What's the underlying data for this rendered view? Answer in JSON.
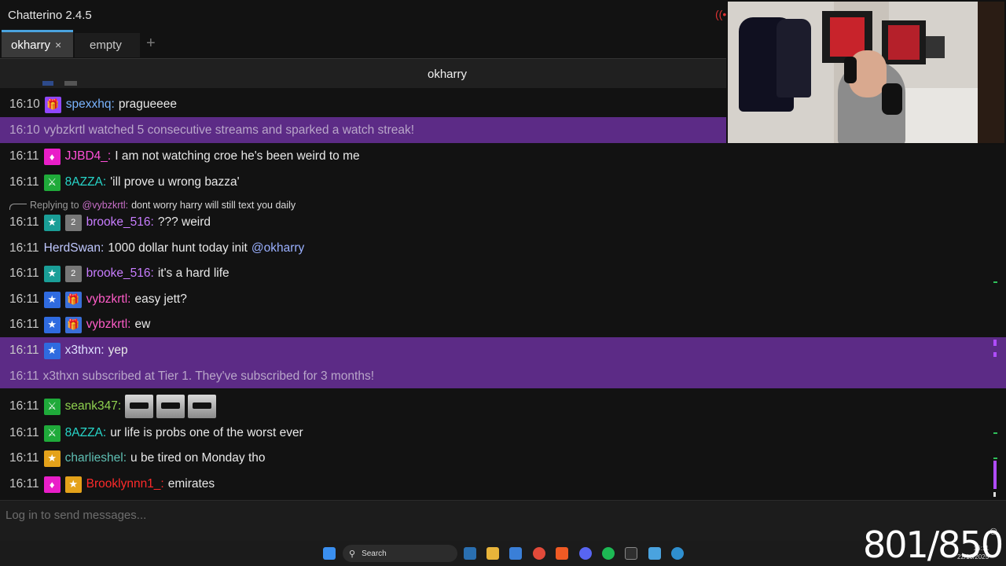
{
  "window": {
    "title": "Chatterino 2.4.5"
  },
  "tabs": [
    {
      "label": "okharry",
      "active": true
    },
    {
      "label": "empty",
      "active": false
    }
  ],
  "icons": {
    "add_tab": "+",
    "close_tab": "×",
    "live": "((•))",
    "emoji": "☺"
  },
  "chat": {
    "channel": "okharry",
    "messages": [
      {
        "time": "16:10",
        "user": "spexxhq:",
        "text": "pragueeee",
        "color": "#7ab4ff"
      },
      {
        "time": "16:10",
        "system": "vybzkrtl watched 5 consecutive streams and sparked a watch streak!"
      },
      {
        "time": "16:11",
        "user": "JJBD4_:",
        "text": "I am not watching croe he's been weird to me",
        "color": "#ff4fd8"
      },
      {
        "time": "16:11",
        "user": "8AZZA:",
        "text": "'ill prove u wrong bazza'",
        "color": "#27d4c8"
      },
      {
        "reply_prefix": "Replying to",
        "reply_target": "@vybzkrtl:",
        "reply_text": "dont worry harry will still text you daily"
      },
      {
        "time": "16:11",
        "user": "brooke_516:",
        "text": "??? weird",
        "color": "#c87dff"
      },
      {
        "time": "16:11",
        "user": "HerdSwan:",
        "text": "1000 dollar hunt today init",
        "mention": "@okharry",
        "color": "#c0c8ff"
      },
      {
        "time": "16:11",
        "user": "brooke_516:",
        "text": "it's a hard life",
        "color": "#c87dff"
      },
      {
        "time": "16:11",
        "user": "vybzkrtl:",
        "text": "easy jett?",
        "color": "#ff5cc8"
      },
      {
        "time": "16:11",
        "user": "vybzkrtl:",
        "text": "ew",
        "color": "#ff5cc8"
      },
      {
        "time": "16:11",
        "user": "x3thxn:",
        "text": "yep",
        "color": "#e0e0ff"
      },
      {
        "time": "16:11",
        "system": "x3thxn subscribed at Tier 1. They've subscribed for 3 months!"
      },
      {
        "time": "16:11",
        "user": "seank347:",
        "text": "",
        "color": "#8fd14f"
      },
      {
        "time": "16:11",
        "user": "8AZZA:",
        "text": "ur life is probs one of the worst ever",
        "color": "#27d4c8"
      },
      {
        "time": "16:11",
        "user": "charlieshel:",
        "text": "u be tired on Monday tho",
        "color": "#5fc0b4"
      },
      {
        "time": "16:11",
        "user": "Brooklynnn1_:",
        "text": "emirates",
        "color": "#ff2a2a"
      }
    ],
    "input_placeholder": "Log in to send messages..."
  },
  "badges": {
    "sub_months_2": "2"
  },
  "taskbar": {
    "search_label": "Search",
    "time": "16:11",
    "date": "22/10/2025"
  },
  "overlay": {
    "counter": "801/850"
  }
}
